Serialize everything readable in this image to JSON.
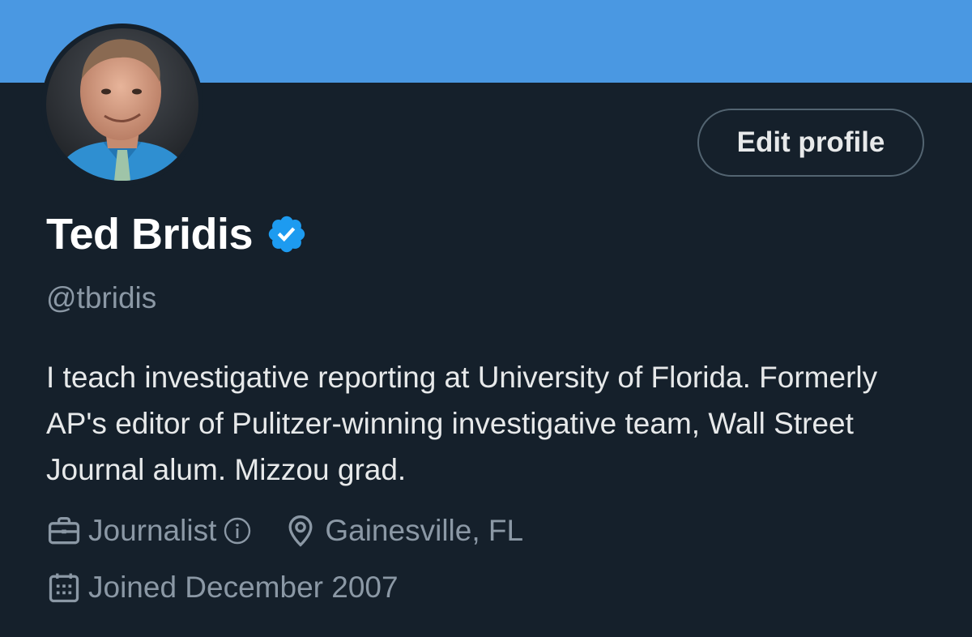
{
  "profile": {
    "display_name": "Ted Bridis",
    "handle": "@tbridis",
    "verified_icon": "verified-badge-icon",
    "bio": "I teach investigative reporting at University of Florida. Formerly AP's editor of Pulitzer-winning investigative team, Wall Street Journal alum. Mizzou grad.",
    "category": "Journalist",
    "location": "Gainesville, FL",
    "joined": "Joined December 2007"
  },
  "actions": {
    "edit_profile_label": "Edit profile"
  },
  "colors": {
    "banner": "#4a98e2",
    "background": "#15202b",
    "verified": "#1d9bf0",
    "secondary_text": "#8b98a5"
  },
  "icons": {
    "category": "briefcase-icon",
    "info": "info-icon",
    "location": "location-pin-icon",
    "joined": "calendar-icon"
  }
}
